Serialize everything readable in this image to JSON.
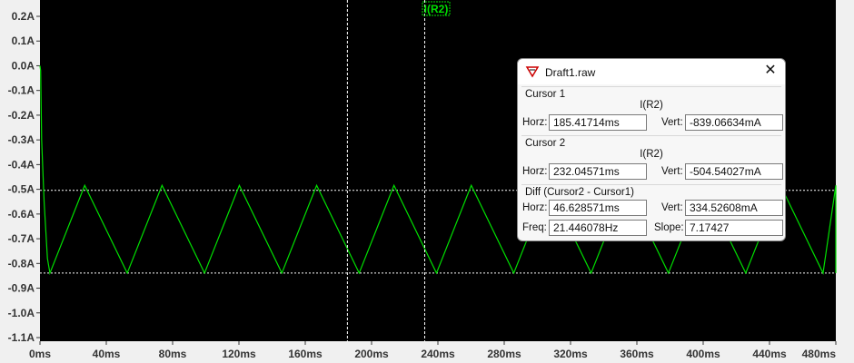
{
  "plot": {
    "trace_title": "I(R2)",
    "background": "#000000",
    "trace_color": "#00e000",
    "grid_color": "#ffffff",
    "y_ticks": [
      "0.2A",
      "0.1A",
      "0.0A",
      "-0.1A",
      "-0.2A",
      "-0.3A",
      "-0.4A",
      "-0.5A",
      "-0.6A",
      "-0.7A",
      "-0.8A",
      "-0.9A",
      "-1.0A",
      "-1.1A"
    ],
    "x_ticks": [
      "0ms",
      "40ms",
      "80ms",
      "120ms",
      "160ms",
      "200ms",
      "240ms",
      "280ms",
      "320ms",
      "360ms",
      "400ms",
      "440ms",
      "480ms"
    ],
    "y_range": [
      -1.1,
      0.2
    ],
    "x_range": [
      0,
      480
    ],
    "cursor1_x_ms": 185.41714,
    "cursor2_x_ms": 232.04571,
    "level_high_A": -0.504,
    "level_low_A": -0.839,
    "frequency_hz": 21.446
  },
  "dialog": {
    "title": "Draft1.raw",
    "cursor1": {
      "title": "Cursor 1",
      "signal": "I(R2)",
      "horz_label": "Horz:",
      "horz": "185.41714ms",
      "vert_label": "Vert:",
      "vert": "-839.06634mA"
    },
    "cursor2": {
      "title": "Cursor 2",
      "signal": "I(R2)",
      "horz_label": "Horz:",
      "horz": "232.04571ms",
      "vert_label": "Vert:",
      "vert": "-504.54027mA"
    },
    "diff": {
      "title": "Diff (Cursor2 - Cursor1)",
      "horz_label": "Horz:",
      "horz": "46.628571ms",
      "vert_label": "Vert:",
      "vert": "334.52608mA",
      "freq_label": "Freq:",
      "freq": "21.446078Hz",
      "slope_label": "Slope:",
      "slope": "7.17427"
    }
  }
}
